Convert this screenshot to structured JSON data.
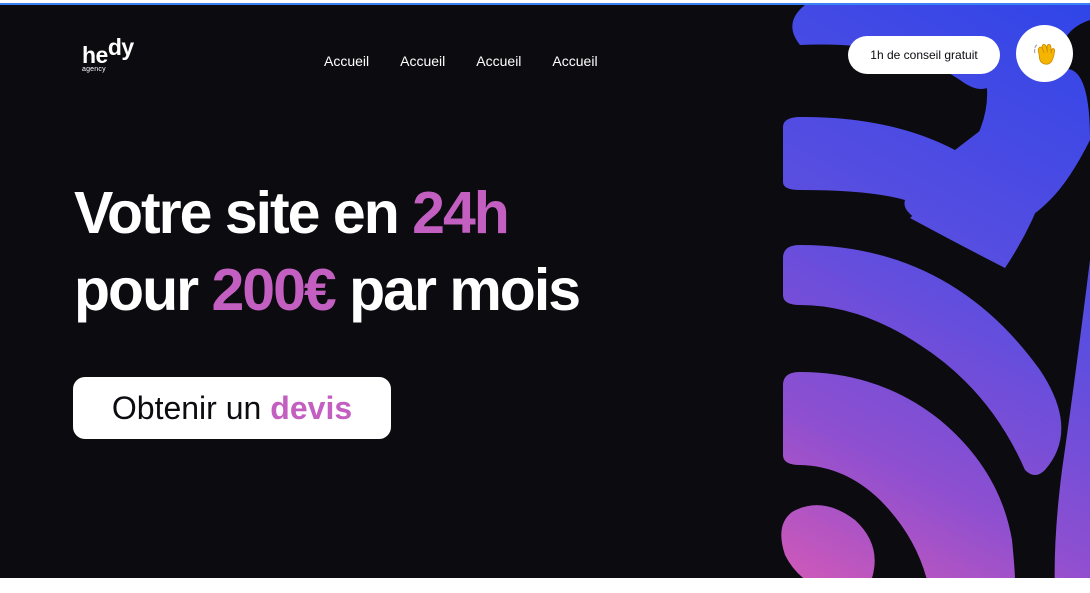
{
  "header": {
    "logo_main": "he",
    "logo_sup": "dy",
    "logo_sub": "agency",
    "nav": [
      "Accueil",
      "Accueil",
      "Accueil",
      "Accueil"
    ],
    "consult_label": "1h de conseil gratuit",
    "wave_emoji": "👋"
  },
  "hero": {
    "line1_text": "Votre site en ",
    "line1_accent": "24h",
    "line2_pre": "pour ",
    "line2_accent": "200€",
    "line2_post": " par mois",
    "cta_text": "Obtenir un",
    "cta_accent": "devis"
  },
  "colors": {
    "background": "#0b0b10",
    "accent": "#c35fc0",
    "gradient_top": "#3448e6",
    "gradient_bottom": "#d45ab7"
  }
}
